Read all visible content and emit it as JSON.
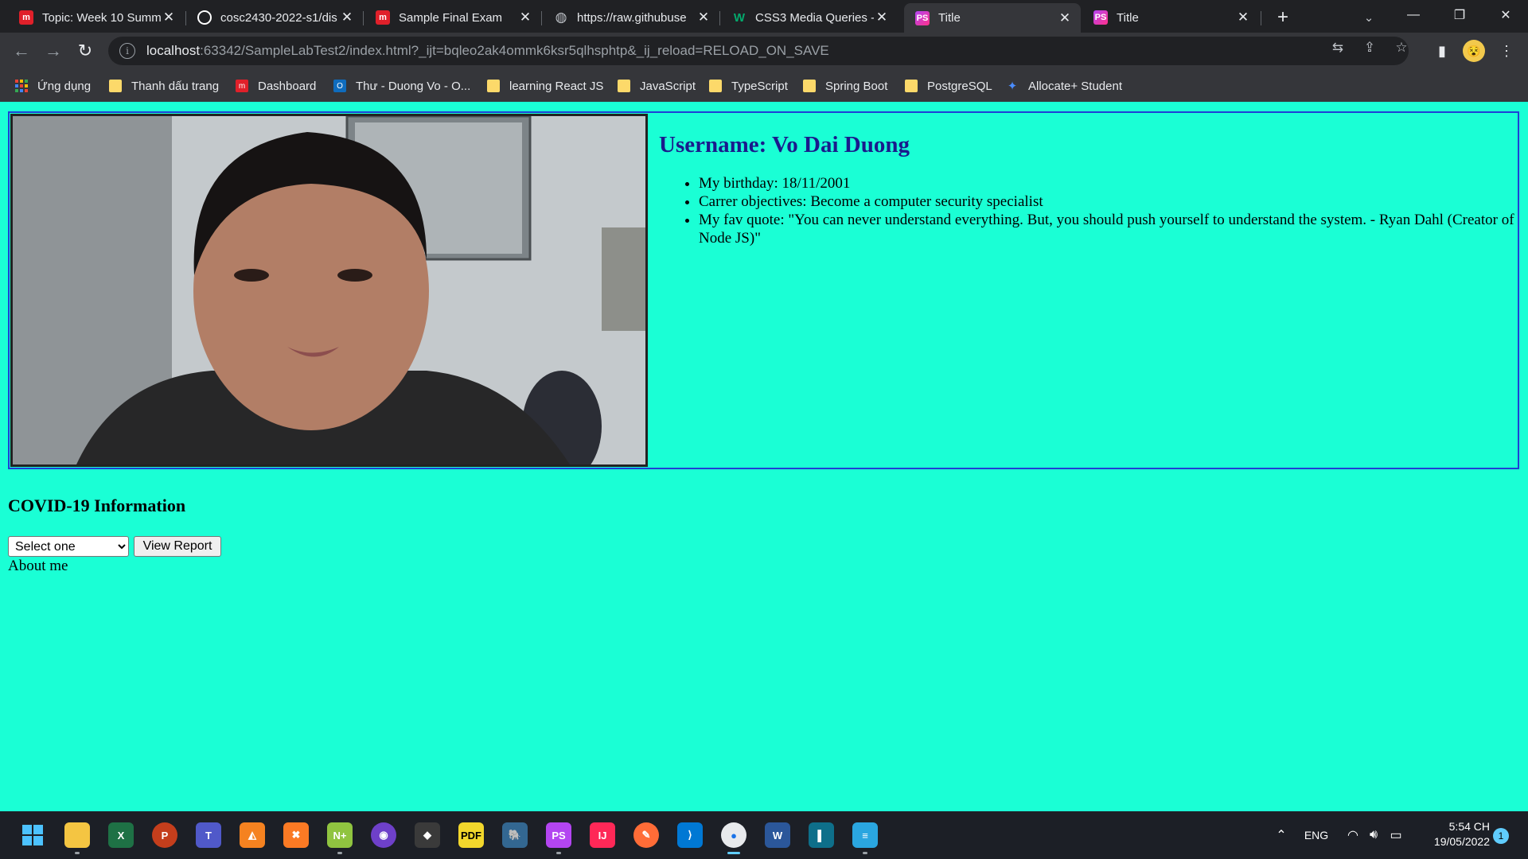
{
  "browser": {
    "tabs": [
      {
        "title": "Topic: Week 10 Summ",
        "icon": "moodle-icon",
        "color": "#e0202a"
      },
      {
        "title": "cosc2430-2022-s1/dis",
        "icon": "github-icon",
        "color": "#ffffff"
      },
      {
        "title": "Sample Final Exam",
        "icon": "moodle-icon",
        "color": "#e0202a"
      },
      {
        "title": "https://raw.githubuse",
        "icon": "globe-icon",
        "color": "#bdc1c6"
      },
      {
        "title": "CSS3 Media Queries -",
        "icon": "w3schools-icon",
        "color": "#04aa6d"
      },
      {
        "title": "Title",
        "icon": "phpstorm-icon",
        "color": "#b345f1"
      },
      {
        "title": "Title",
        "icon": "phpstorm-icon",
        "color": "#b345f1"
      }
    ],
    "active_tab": 5,
    "url_host": "localhost",
    "url_rest": ":63342/SampleLabTest2/index.html?_ijt=bqleo2ak4ommk6ksr5qlhsphtp&_ij_reload=RELOAD_ON_SAVE",
    "bookmarks": [
      {
        "label": "Ứng dụng",
        "icon": "apps-icon"
      },
      {
        "label": "Thanh dấu trang",
        "icon": "folder-icon"
      },
      {
        "label": "Dashboard",
        "icon": "moodle-icon"
      },
      {
        "label": "Thư - Duong Vo - O...",
        "icon": "outlook-icon"
      },
      {
        "label": "learning React JS",
        "icon": "folder-icon"
      },
      {
        "label": "JavaScript",
        "icon": "folder-icon"
      },
      {
        "label": "TypeScript",
        "icon": "folder-icon"
      },
      {
        "label": "Spring Boot",
        "icon": "folder-icon"
      },
      {
        "label": "PostgreSQL",
        "icon": "folder-icon"
      },
      {
        "label": "Allocate+ Student",
        "icon": "allocate-icon"
      }
    ]
  },
  "page": {
    "username_heading": "Username: Vo Dai Duong",
    "details": [
      "My birthday: 18/11/2001",
      "Carrer objectives: Become a computer security specialist",
      "My fav quote: \"You can never understand everything. But, you should push yourself to understand the system. - Ryan Dahl (Creator of Node JS)\""
    ],
    "covid_title": "COVID-19 Information",
    "select_value": "Select one",
    "view_report_label": "View Report",
    "about_link": "About me",
    "background": "#1affd5"
  },
  "taskbar": {
    "apps": [
      "start-icon",
      "file-explorer-icon",
      "excel-icon",
      "powerpoint-icon",
      "teams-icon",
      "app-icon",
      "xampp-icon",
      "notepad-plus-icon",
      "github-desktop-icon",
      "git-icon",
      "pdf-icon",
      "postgresql-icon",
      "phpstorm-icon",
      "intellij-icon",
      "postman-icon",
      "vscode-icon",
      "chrome-icon",
      "word-icon",
      "terminal-icon",
      "notepad-icon"
    ],
    "language": "ENG",
    "time": "5:54 CH",
    "date": "19/05/2022",
    "notifications": "1"
  }
}
